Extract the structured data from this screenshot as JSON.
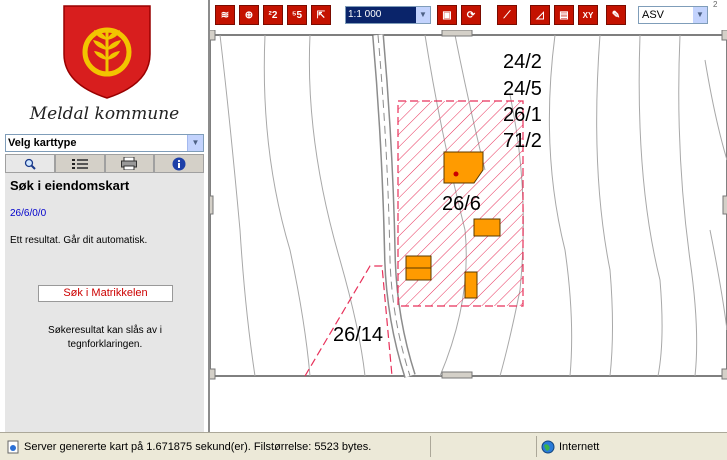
{
  "sidebar": {
    "municipality_name": "Meldal kommune",
    "map_type_select": "Velg karttype",
    "tabs": [
      {
        "icon": "search-icon"
      },
      {
        "icon": "legend-icon"
      },
      {
        "icon": "print-icon"
      },
      {
        "icon": "info-icon"
      }
    ],
    "panel": {
      "title": "Søk i eiendomskart",
      "result_link": "26/6/0/0",
      "result_text": "Ett resultat. Går dit automatisk.",
      "matrikkel_button": "Søk i Matrikkelen",
      "help_text": "Søkeresultat kan slås av i tegnforklaringen."
    }
  },
  "toolbar": {
    "buttons": [
      {
        "icon": "layers-icon"
      },
      {
        "icon": "zoom-extent-icon"
      },
      {
        "icon": "zoom-2-icon",
        "label": "²2"
      },
      {
        "icon": "zoom-5-icon",
        "label": "⁵5"
      },
      {
        "icon": "pan-icon"
      },
      {
        "icon": "refresh-map-icon"
      },
      {
        "icon": "redraw-icon"
      },
      {
        "icon": "link-icon"
      },
      {
        "icon": "measure-area-icon"
      },
      {
        "icon": "measure-length-icon"
      },
      {
        "icon": "xy-coordinate-icon",
        "label": "XY"
      },
      {
        "icon": "ruler-icon"
      }
    ],
    "scale_value": "1:1 000",
    "coord_system_value": "ASV",
    "corner_mark": "2"
  },
  "map": {
    "parcel_labels": [
      "24/2",
      "24/5",
      "26/1",
      "71/2"
    ],
    "main_parcel": "26/6",
    "neighbor_parcel": "26/14",
    "colors": {
      "parcel_hatch": "#e8315a",
      "building_fill": "#ff9b00",
      "building_stroke": "#5a3a00",
      "contour": "#a8a8a8",
      "road": "#8c8c8c"
    }
  },
  "statusbar": {
    "message": "Server genererte kart på 1.671875 sekund(er). Filstørrelse: 5523 bytes.",
    "zone": "Internett"
  }
}
